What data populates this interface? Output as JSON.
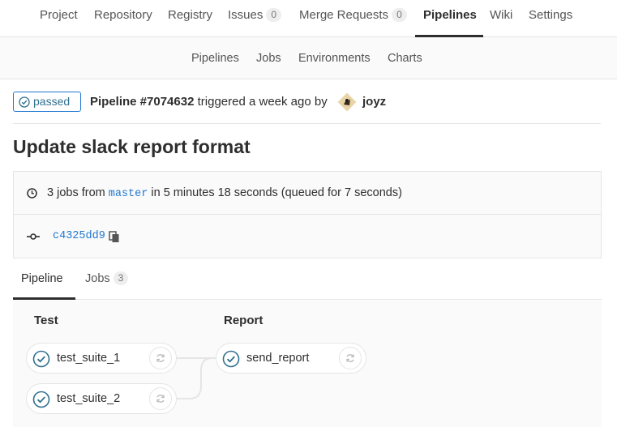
{
  "top_nav": {
    "project": "Project",
    "repository": "Repository",
    "registry": "Registry",
    "issues": "Issues",
    "issues_count": "0",
    "merge_requests": "Merge Requests",
    "merge_requests_count": "0",
    "pipelines": "Pipelines",
    "wiki": "Wiki",
    "settings": "Settings"
  },
  "sub_nav": {
    "pipelines": "Pipelines",
    "jobs": "Jobs",
    "environments": "Environments",
    "charts": "Charts"
  },
  "status": {
    "badge": "passed",
    "pipeline_id": "Pipeline #7074632",
    "triggered_text": " triggered a week ago by",
    "username": "joyz"
  },
  "title": "Update slack report format",
  "info": {
    "jobs_prefix": "3 jobs from ",
    "branch": "master",
    "jobs_suffix": " in 5 minutes 18 seconds (queued for 7 seconds)",
    "commit_sha": "c4325dd9"
  },
  "tabs": {
    "pipeline": "Pipeline",
    "jobs": "Jobs",
    "jobs_count": "3"
  },
  "stages": [
    {
      "title": "Test",
      "jobs": [
        "test_suite_1",
        "test_suite_2"
      ]
    },
    {
      "title": "Report",
      "jobs": [
        "send_report"
      ]
    }
  ],
  "colors": {
    "success": "#31708f",
    "link": "#1f78d1",
    "border": "#e5e5e5"
  },
  "icons": {
    "status": "check-circle-icon",
    "clock": "clock-icon",
    "commit": "commit-icon",
    "copy": "clipboard-icon",
    "retry": "retry-icon"
  }
}
